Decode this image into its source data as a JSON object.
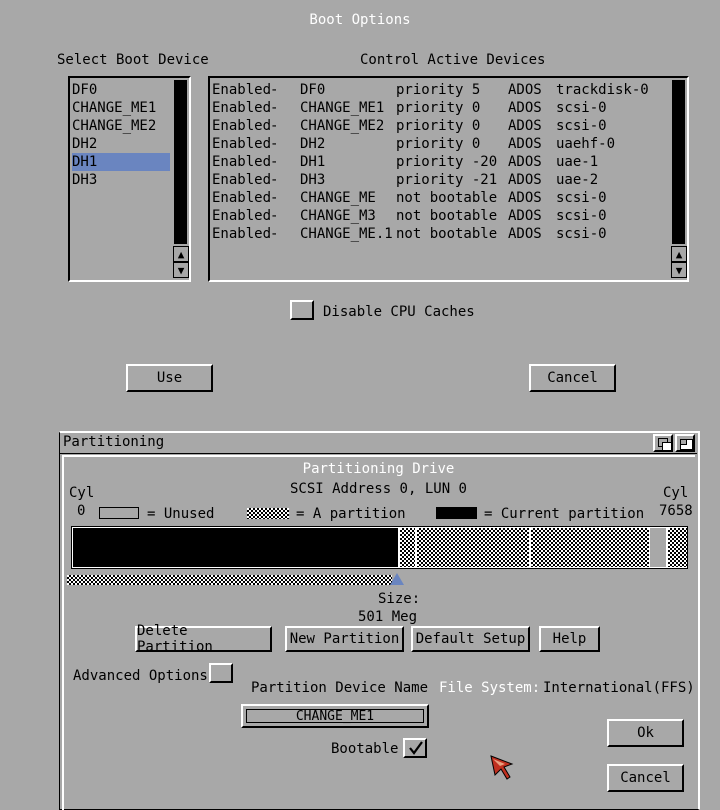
{
  "boot": {
    "title": "Boot Options",
    "select_label": "Select Boot Device",
    "control_label": "Control Active Devices",
    "devices": [
      "DF0",
      "CHANGE_ME1",
      "CHANGE_ME2",
      "DH2",
      "DH1",
      "DH3"
    ],
    "selected_device_index": 4,
    "active_devices": [
      {
        "state": "Enabled",
        "name": "DF0",
        "priority": "priority 5",
        "fs": "ADOS",
        "driver": "trackdisk-0"
      },
      {
        "state": "Enabled",
        "name": "CHANGE_ME1",
        "priority": "priority 0",
        "fs": "ADOS",
        "driver": "scsi-0"
      },
      {
        "state": "Enabled",
        "name": "CHANGE_ME2",
        "priority": "priority 0",
        "fs": "ADOS",
        "driver": "scsi-0"
      },
      {
        "state": "Enabled",
        "name": "DH2",
        "priority": "priority 0",
        "fs": "ADOS",
        "driver": "uaehf-0"
      },
      {
        "state": "Enabled",
        "name": "DH1",
        "priority": "priority -20",
        "fs": "ADOS",
        "driver": "uae-1"
      },
      {
        "state": "Enabled",
        "name": "DH3",
        "priority": "priority -21",
        "fs": "ADOS",
        "driver": "uae-2"
      },
      {
        "state": "Enabled",
        "name": "CHANGE_ME",
        "priority": "not bootable",
        "fs": "ADOS",
        "driver": "scsi-0"
      },
      {
        "state": "Enabled",
        "name": "CHANGE_M3",
        "priority": "not bootable",
        "fs": "ADOS",
        "driver": "scsi-0"
      },
      {
        "state": "Enabled",
        "name": "CHANGE_ME.1",
        "priority": "not bootable",
        "fs": "ADOS",
        "driver": "scsi-0"
      }
    ],
    "disable_caches_label": "Disable CPU Caches",
    "disable_caches_checked": false,
    "use_label": "Use",
    "cancel_label": "Cancel"
  },
  "partitioning": {
    "window_title": "Partitioning",
    "heading": "Partitioning Drive",
    "address": "SCSI Address 0, LUN 0",
    "cyl_label": "Cyl",
    "cyl_start": "0",
    "cyl_end": "7658",
    "legend_unused": "= Unused",
    "legend_partition": "= A partition",
    "legend_current": "= Current partition",
    "size_label": "Size:",
    "size_value": "501 Meg",
    "buttons": {
      "delete": "Delete Partition",
      "new": "New Partition",
      "default": "Default Setup",
      "help": "Help"
    },
    "advanced_label": "Advanced Options",
    "device_name_label": "Partition Device Name",
    "device_name_value": "CHANGE_ME1",
    "fs_label": "File System:",
    "fs_value": "International(FFS)",
    "bootable_label": "Bootable",
    "bootable_checked": true,
    "ok_label": "Ok",
    "cancel_label": "Cancel"
  },
  "icons": [
    "arrow-up-icon",
    "arrow-down-icon",
    "checkmark-icon",
    "depth-gadget-icon",
    "zoom-gadget-icon",
    "mouse-pointer-icon"
  ],
  "colors": {
    "background": "#a8a8a8",
    "selection": "#6a85c0",
    "titlebar_text": "#ffffff",
    "pointer": "#c03020"
  }
}
